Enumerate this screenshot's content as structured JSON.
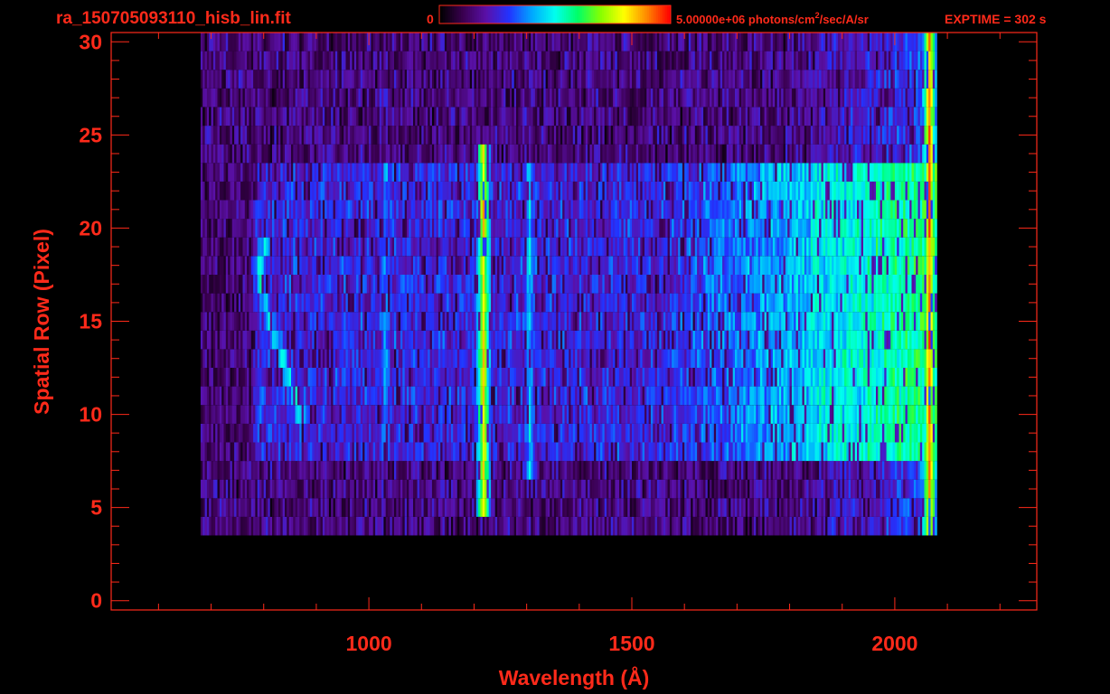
{
  "header": {
    "filename": "ra_150705093110_hisb_lin.fit",
    "cbar_min_label": "0",
    "cbar_max_label": "5.00000e+06 photons/cm",
    "cbar_max_sup": "2",
    "cbar_max_tail": "/sec/A/sr",
    "exptime_label": "EXPTIME = 302 s"
  },
  "colors": {
    "text": "#ff2a1a",
    "axis": "#ff2a1a",
    "background": "#000000",
    "colormap": [
      "#000000",
      "#3a0050",
      "#5a10a8",
      "#2233ff",
      "#00a8ff",
      "#00ffee",
      "#00ff66",
      "#88ff00",
      "#ffff00",
      "#ff8800",
      "#ff0000"
    ]
  },
  "chart_data": {
    "type": "heatmap",
    "title": "",
    "xlabel": "Wavelength (Å)",
    "ylabel": "Spatial Row (Pixel)",
    "xlim": [
      510,
      2270
    ],
    "ylim": [
      -0.5,
      30.5
    ],
    "x_ticks": [
      1000,
      1500,
      2000
    ],
    "x_tick_labels": [
      "1000",
      "1500",
      "2000"
    ],
    "y_ticks": [
      0,
      5,
      10,
      15,
      20,
      25,
      30
    ],
    "y_tick_labels": [
      "0",
      "5",
      "10",
      "15",
      "20",
      "25",
      "30"
    ],
    "colorbar": {
      "min": 0,
      "max": 5000000,
      "units": "photons/cm2/sec/A/sr"
    },
    "rows": 31,
    "data_x_range": [
      680,
      2080
    ],
    "bright_slit_rows": [
      8,
      23
    ],
    "faint_rows": [
      [
        4,
        7
      ],
      [
        24,
        30
      ]
    ],
    "features": [
      {
        "wavelength": 1216,
        "rows": [
          5,
          24
        ],
        "level": 0.82
      },
      {
        "wavelength": 1304,
        "rows": [
          7,
          23
        ],
        "level": 0.45
      },
      {
        "wavelength": 1030,
        "rows": [
          8,
          23
        ],
        "level": 0.4
      },
      {
        "wavelength": 2064,
        "rows": [
          2,
          30
        ],
        "level": 0.9
      }
    ],
    "arc_feature": {
      "rows": [
        10,
        19
      ],
      "wavelengths": [
        868,
        858,
        846,
        834,
        822,
        810,
        800,
        792,
        790,
        800
      ]
    },
    "continuum": {
      "start_wavelength": 1550,
      "end_wavelength": 2060,
      "max_level": 0.58
    },
    "grid": false
  }
}
